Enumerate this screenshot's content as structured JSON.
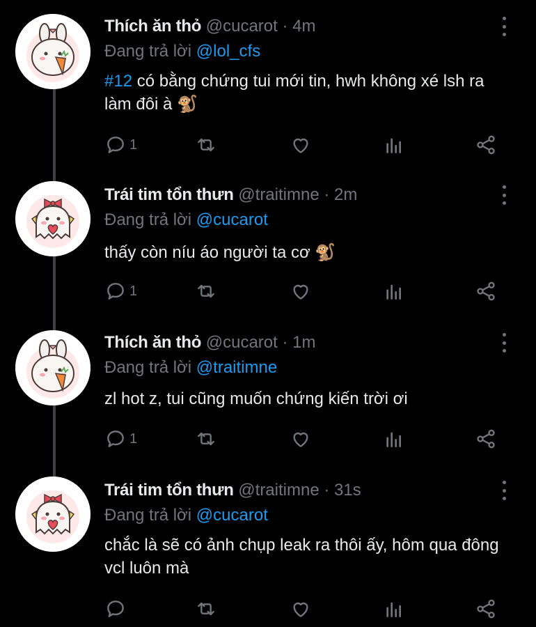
{
  "tweets": [
    {
      "name": "Thích ăn thỏ",
      "handle": "@cucarot",
      "dot": "·",
      "time": "4m",
      "reply_prefix": "Đang trả lời ",
      "reply_to": "@lol_cfs",
      "hashtag": "#12",
      "text": " có bằng chứng tui mới tin, hwh không xé lsh ra làm đôi à 🐒",
      "reply_count": "1",
      "avatar": "bunny-with-carrot"
    },
    {
      "name": "Trái tim tổn thưn",
      "handle": "@traitimne",
      "dot": "·",
      "time": "2m",
      "reply_prefix": "Đang trả lời ",
      "reply_to": "@cucarot",
      "hashtag": "",
      "text": "thấy còn níu áo người ta cơ 🐒",
      "reply_count": "1",
      "avatar": "ghost-with-heart"
    },
    {
      "name": "Thích ăn thỏ",
      "handle": "@cucarot",
      "dot": "·",
      "time": "1m",
      "reply_prefix": "Đang trả lời ",
      "reply_to": "@traitimne",
      "hashtag": "",
      "text": "zl hot z, tui cũng muốn chứng kiến trời ơi",
      "reply_count": "1",
      "avatar": "bunny-with-carrot"
    },
    {
      "name": "Trái tim tổn thưn",
      "handle": "@traitimne",
      "dot": "·",
      "time": "31s",
      "reply_prefix": "Đang trả lời ",
      "reply_to": "@cucarot",
      "hashtag": "",
      "text": "chắc là sẽ có ảnh chụp leak ra thôi ấy, hôm qua đông vcl luôn mà",
      "reply_count": "",
      "avatar": "ghost-with-heart"
    }
  ],
  "icons": {
    "reply": "reply-icon",
    "retweet": "retweet-icon",
    "like": "like-icon",
    "analytics": "analytics-icon",
    "share": "share-icon",
    "more": "more-options-icon"
  },
  "colors": {
    "background": "#000000",
    "text": "#e7e9ea",
    "muted": "#71767b",
    "accent": "#1d9bf0",
    "thread_line": "#3e4144"
  }
}
